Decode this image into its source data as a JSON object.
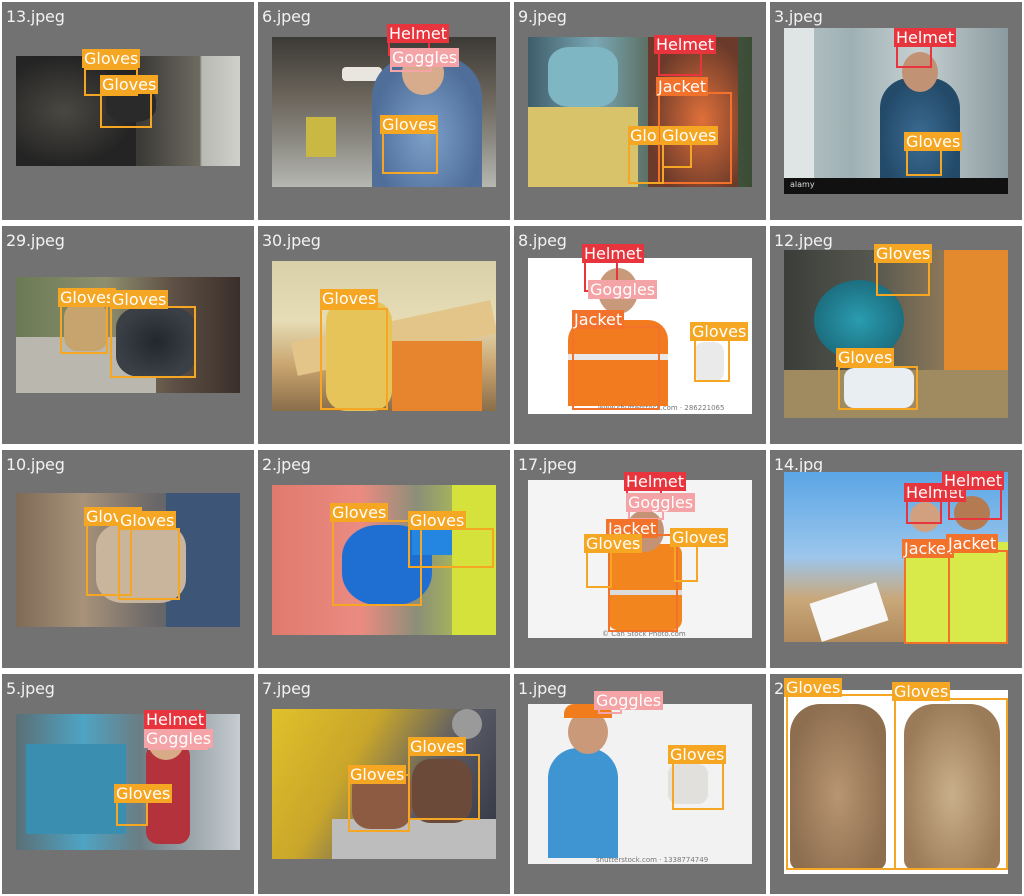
{
  "classes": {
    "Gloves": "#f5a623",
    "Helmet": "#e8343c",
    "Goggles": "#f4a3a6",
    "Jacket": "#f2712b"
  },
  "tiles": [
    {
      "file": "13.jpeg",
      "labels": [
        "Gloves",
        "Gloves"
      ]
    },
    {
      "file": "6.jpeg",
      "labels": [
        "Helmet",
        "Goggles",
        "Gloves"
      ]
    },
    {
      "file": "9.jpeg",
      "labels": [
        "Helmet",
        "Jacket",
        "Glo",
        "Gloves"
      ]
    },
    {
      "file": "3.jpeg",
      "labels": [
        "Helmet",
        "Gloves"
      ],
      "watermark": "alamy"
    },
    {
      "file": "29.jpeg",
      "labels": [
        "Gloves",
        "Gloves"
      ]
    },
    {
      "file": "30.jpeg",
      "labels": [
        "Gloves"
      ]
    },
    {
      "file": "8.jpeg",
      "labels": [
        "Helmet",
        "Goggles",
        "Jacket",
        "Gloves"
      ],
      "watermark": "www.shutterstock.com · 286221065"
    },
    {
      "file": "12.jpeg",
      "labels": [
        "Gloves",
        "Gloves"
      ]
    },
    {
      "file": "10.jpeg",
      "labels": [
        "Gloves",
        "Gloves"
      ]
    },
    {
      "file": "2.jpeg",
      "labels": [
        "Gloves",
        "Gloves"
      ]
    },
    {
      "file": "17.jpeg",
      "labels": [
        "Helmet",
        "Goggles",
        "Jacket",
        "Gloves",
        "Gloves"
      ],
      "watermark": "© Can Stock Photo.com"
    },
    {
      "file": "14.jpg",
      "labels": [
        "Helmet",
        "Helmet",
        "Jacket",
        "Jacket"
      ]
    },
    {
      "file": "5.jpeg",
      "labels": [
        "Helmet",
        "Goggles",
        "Gloves"
      ]
    },
    {
      "file": "7.jpeg",
      "labels": [
        "Gloves",
        "Gloves"
      ]
    },
    {
      "file": "1.jpeg",
      "labels": [
        "Goggles",
        "Gloves"
      ],
      "watermark": "shutterstock.com · 1338774749"
    },
    {
      "file": "2",
      "labels": [
        "Gloves",
        "Gloves"
      ]
    }
  ]
}
